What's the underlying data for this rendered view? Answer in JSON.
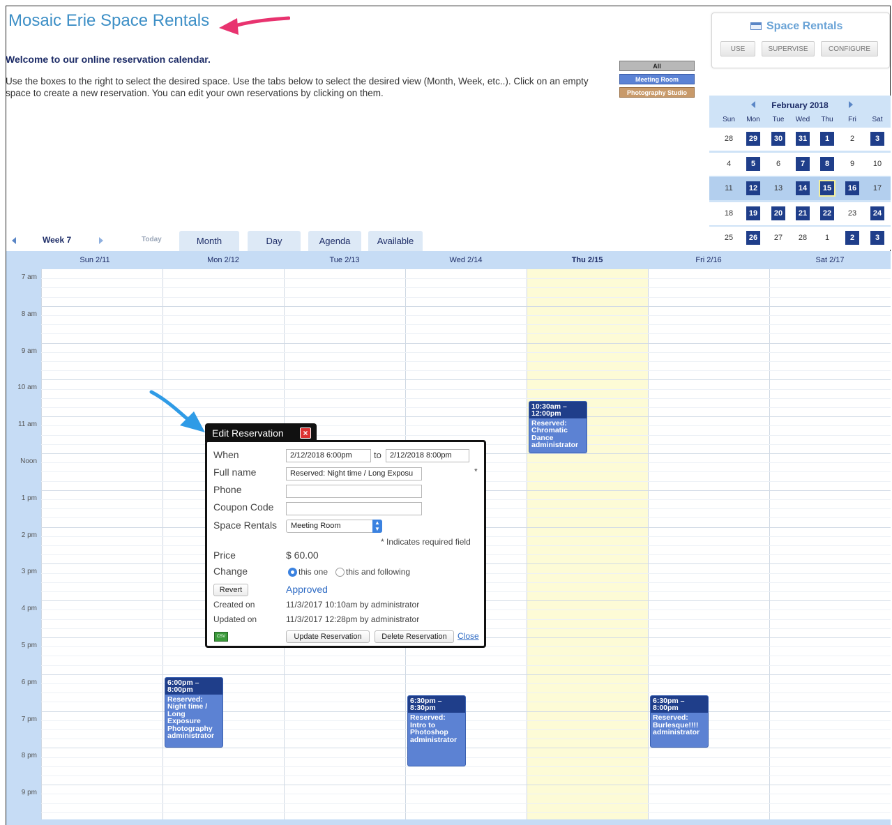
{
  "header": {
    "title": "Mosaic Erie Space Rentals",
    "welcome": "Welcome to our online reservation calendar.",
    "instructions": "Use the boxes to the right to select the desired space.  Use the tabs below to select the desired view (Month, Week, etc..). Click on an empty space to create a new reservation. You can edit your own reservations by clicking on them."
  },
  "filters": [
    {
      "label": "All",
      "color": "#b8b8b8"
    },
    {
      "label": "Meeting Room",
      "color": "#5b82d4"
    },
    {
      "label": "Photography Studio",
      "color": "#c89a6a"
    }
  ],
  "space_rentals_panel": {
    "title": "Space Rentals",
    "icon": "calendar-window-icon",
    "buttons": [
      "USE",
      "SUPERVISE",
      "CONFIGURE"
    ]
  },
  "mini_calendar": {
    "month": "February 2018",
    "dow": [
      "Sun",
      "Mon",
      "Tue",
      "Wed",
      "Thu",
      "Fri",
      "Sat"
    ],
    "weeks": [
      [
        "28",
        "29",
        "30",
        "31",
        "1",
        "2",
        "3"
      ],
      [
        "4",
        "5",
        "6",
        "7",
        "8",
        "9",
        "10"
      ],
      [
        "11",
        "12",
        "13",
        "14",
        "15",
        "16",
        "17"
      ],
      [
        "18",
        "19",
        "20",
        "21",
        "22",
        "23",
        "24"
      ],
      [
        "25",
        "26",
        "27",
        "28",
        "1",
        "2",
        "3"
      ]
    ],
    "busy": [
      [
        false,
        true,
        true,
        true,
        true,
        false,
        true
      ],
      [
        false,
        true,
        false,
        true,
        true,
        false,
        false
      ],
      [
        false,
        true,
        false,
        true,
        true,
        true,
        false
      ],
      [
        false,
        true,
        true,
        true,
        true,
        false,
        true
      ],
      [
        false,
        true,
        false,
        false,
        false,
        true,
        true
      ]
    ],
    "current_week": 2,
    "today": [
      2,
      4
    ]
  },
  "nav": {
    "week_label": "Week 7",
    "today": "Today",
    "tabs": [
      "Month",
      "Day",
      "Agenda",
      "Available"
    ]
  },
  "days": [
    "Sun 2/11",
    "Mon 2/12",
    "Tue 2/13",
    "Wed 2/14",
    "Thu 2/15",
    "Fri 2/16",
    "Sat 2/17"
  ],
  "today_index": 4,
  "times": [
    "7 am",
    "8 am",
    "9 am",
    "10 am",
    "11 am",
    "Noon",
    "1 pm",
    "2 pm",
    "3 pm",
    "4 pm",
    "5 pm",
    "6 pm",
    "7 pm",
    "8 pm",
    "9 pm"
  ],
  "events": [
    {
      "day": 1,
      "start": 18.0,
      "end": 20.0,
      "time": "6:00pm – 8:00pm",
      "body": "Reserved: Night time / Long Exposure Photography administrator"
    },
    {
      "day": 3,
      "start": 18.5,
      "end": 20.5,
      "time": "6:30pm – 8:30pm",
      "body": "Reserved: Intro to Photoshop administrator"
    },
    {
      "day": 4,
      "start": 10.5,
      "end": 12.0,
      "time": "10:30am – 12:00pm",
      "body": "Reserved: Chromatic Dance administrator"
    },
    {
      "day": 5,
      "start": 18.5,
      "end": 20.0,
      "time": "6:30pm – 8:00pm",
      "body": "Reserved: Burlesque!!!! administrator"
    }
  ],
  "dialog": {
    "title": "Edit Reservation",
    "labels": {
      "when": "When",
      "to": "to",
      "full_name": "Full name",
      "phone": "Phone",
      "coupon": "Coupon Code",
      "space": "Space Rentals",
      "required_note": "* Indicates required field",
      "price": "Price",
      "change": "Change",
      "created": "Created on",
      "updated": "Updated on"
    },
    "when_start": "2/12/2018 6:00pm",
    "when_end": "2/12/2018 8:00pm",
    "full_name_value": "Reserved: Night time / Long Exposu",
    "required_mark": "*",
    "phone_value": "",
    "coupon_value": "",
    "space_value": "Meeting Room",
    "price_value": "$ 60.00",
    "change_options": [
      "this one",
      "this and following"
    ],
    "revert": "Revert",
    "status": "Approved",
    "created_value": "11/3/2017 10:10am by administrator",
    "updated_value": "11/3/2017 12:28pm by administrator",
    "update_button": "Update Reservation",
    "delete_button": "Delete Reservation",
    "close_link": "Close",
    "csv_icon_text": "CSV"
  },
  "colors": {
    "accent": "#3d8fc6",
    "event": "#5c82d3",
    "event_header": "#1f3e8a",
    "today_bg": "#fdfbd6",
    "arrow_pink": "#e8336f",
    "arrow_blue": "#2f9be6"
  }
}
